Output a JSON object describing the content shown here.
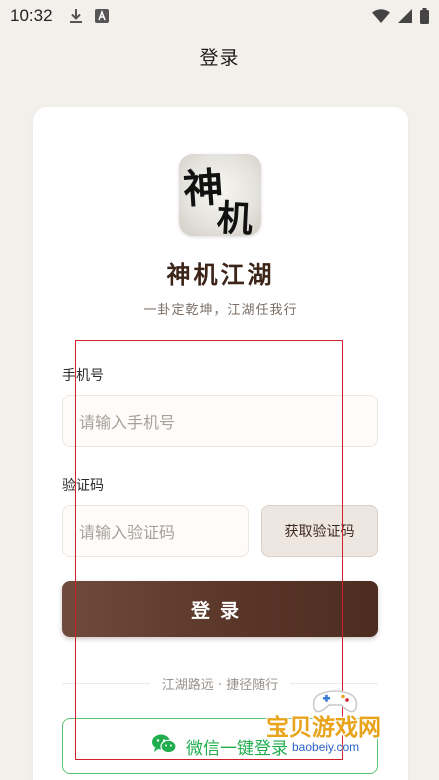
{
  "status_bar": {
    "time": "10:32",
    "icons": [
      "download-icon",
      "a-badge-icon",
      "wifi-icon",
      "signal-icon",
      "battery-icon"
    ]
  },
  "header": {
    "title": "登录"
  },
  "card": {
    "logo": {
      "char1": "神",
      "char2": "机"
    },
    "app_name": "神机江湖",
    "slogan": "一卦定乾坤，江湖任我行",
    "phone": {
      "label": "手机号",
      "placeholder": "请输入手机号"
    },
    "code": {
      "label": "验证码",
      "placeholder": "请输入验证码",
      "get_code_label": "获取验证码"
    },
    "login_label": "登录",
    "divider_text": "江湖路远 · 捷径随行",
    "wechat_label": "微信一键登录"
  },
  "watermark": {
    "text": "宝贝游戏网",
    "url": "baobeiy.com"
  },
  "colors": {
    "background": "#f3f0ec",
    "primary_brown": "#5a3628",
    "wechat_green": "#1fad4e",
    "highlight_red": "#d0202a"
  }
}
